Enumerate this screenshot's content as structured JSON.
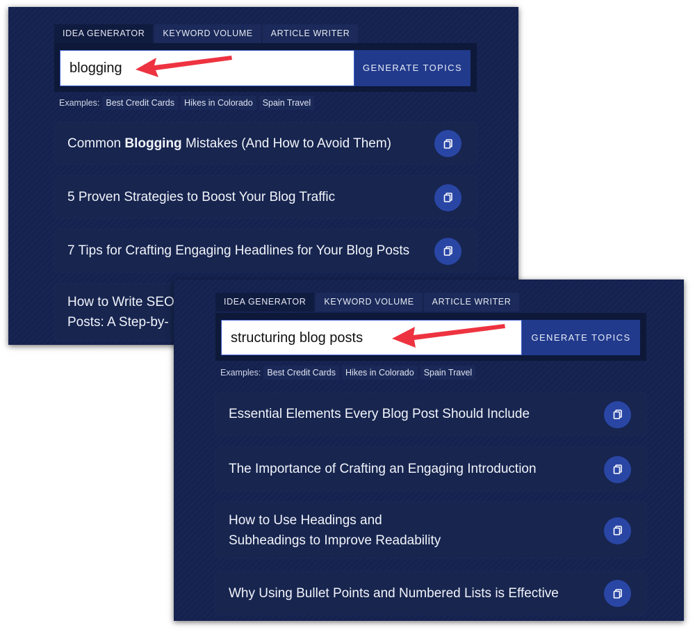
{
  "colors": {
    "background": "#15224f",
    "button": "#213a8c",
    "copy_button": "#2a46a5",
    "arrow": "#ee3340"
  },
  "screens": [
    {
      "tabs": [
        "IDEA GENERATOR",
        "KEYWORD VOLUME",
        "ARTICLE WRITER"
      ],
      "input_value": "blogging",
      "button_label": "GENERATE TOPICS",
      "examples_label": "Examples:",
      "examples": [
        "Best Credit Cards",
        "Hikes in Colorado",
        "Spain Travel"
      ],
      "results": [
        {
          "before": "Common ",
          "bold": "Blogging",
          "after": " Mistakes (And How to Avoid Them)"
        },
        {
          "text": "5 Proven Strategies to Boost Your Blog Traffic"
        },
        {
          "text": "7 Tips for Crafting Engaging Headlines for Your Blog Posts"
        },
        {
          "line1": "How to Write SEO",
          "line2": "Posts: A Step-by-"
        }
      ]
    },
    {
      "tabs": [
        "IDEA GENERATOR",
        "KEYWORD VOLUME",
        "ARTICLE WRITER"
      ],
      "input_value": "structuring blog posts",
      "button_label": "GENERATE TOPICS",
      "examples_label": "Examples:",
      "examples": [
        "Best Credit Cards",
        "Hikes in Colorado",
        "Spain Travel"
      ],
      "results": [
        {
          "text": "Essential Elements Every Blog Post Should Include"
        },
        {
          "text": "The Importance of Crafting an Engaging Introduction"
        },
        {
          "line1": "How to Use Headings and",
          "line2": "Subheadings to Improve Readability"
        },
        {
          "text": "Why Using Bullet Points and Numbered Lists is Effective"
        }
      ]
    }
  ]
}
